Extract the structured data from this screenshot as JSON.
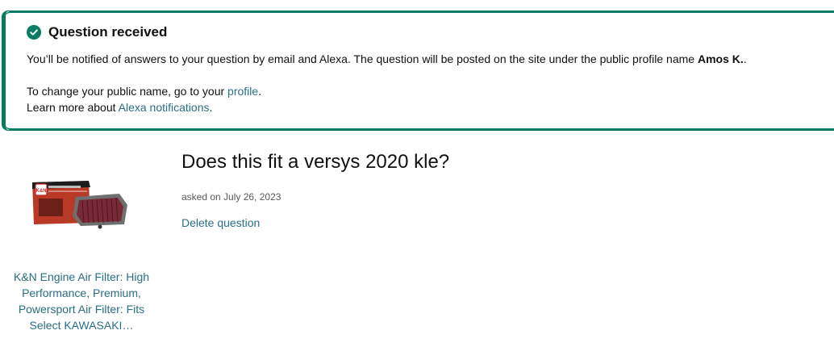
{
  "alert": {
    "title": "Question received",
    "icon": "check-circle-icon",
    "accent_color": "#067d62",
    "line1_prefix": "You’ll be notified of answers to your question by email and Alexa. The question will be posted on the site under the public profile name ",
    "profile_name": "Amos K.",
    "line1_suffix": ".",
    "line2_prefix": "To change your public name, go to your ",
    "profile_link": "profile",
    "line2_suffix": ".",
    "line3_prefix": "Learn more about ",
    "notifications_link": "Alexa notifications",
    "line3_suffix": "."
  },
  "product": {
    "title": "K&N Engine Air Filter: High Performance, Premium, Powersport Air Filter: Fits Select KAWASAKI…",
    "image_brand_text": "K&N"
  },
  "question": {
    "text": "Does this fit a versys 2020 kle?",
    "asked": "asked on July 26, 2023",
    "delete_label": "Delete question"
  }
}
